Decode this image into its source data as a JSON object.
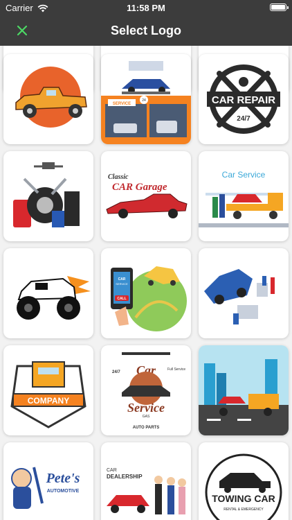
{
  "status_bar": {
    "carrier": "Carrier",
    "time": "11:58 PM",
    "battery": 1.0
  },
  "nav": {
    "title": "Select Logo",
    "close_icon": "close-icon"
  },
  "logos": {
    "garage_text_1": "Classic",
    "garage_text_2": "CAR Garage",
    "service_banner": "SERVICE",
    "service_24": "24",
    "car_service_title": "Car Service",
    "car_repair_1": "CAR REPAIR",
    "car_repair_2": "24/7",
    "phone_1": "CAR",
    "phone_2": "SERVICE",
    "phone_3": "CALL",
    "company": "COMPANY",
    "svc_247": "24/7",
    "svc_full": "Full Service",
    "svc_car": "Car",
    "svc_service": "Service",
    "svc_gas": "GAS",
    "svc_parts": "AUTO PARTS",
    "petes_1": "Pete's",
    "petes_2": "AUTOMOTIVE",
    "dealer_1": "CAR",
    "dealer_2": "DEALERSHIP",
    "towing": "TOWING CAR",
    "towing_sub": "RENTAL & EMERGENCY"
  },
  "colors": {
    "bar": "#3c3c3c",
    "close": "#4cd964"
  }
}
